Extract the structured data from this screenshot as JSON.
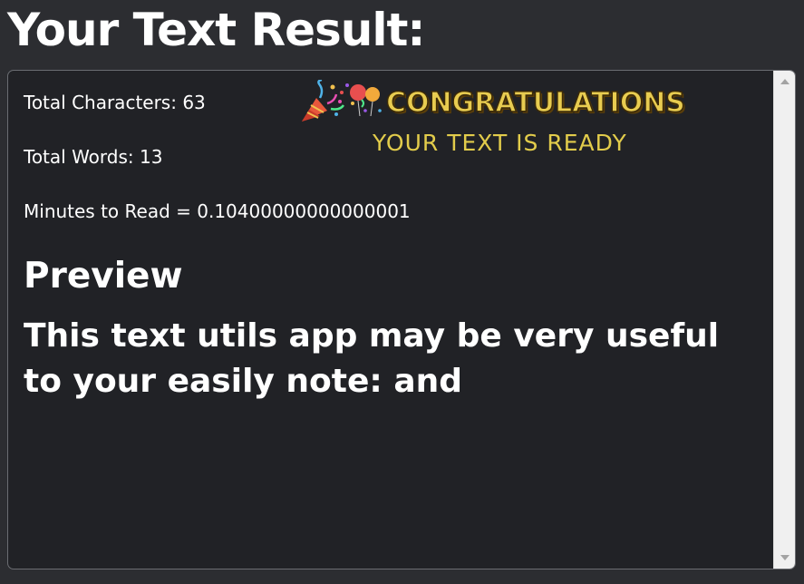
{
  "page": {
    "title": "Your Text Result:"
  },
  "stats": {
    "total_characters": "Total Characters: 63",
    "total_words": "Total Words: 13",
    "minutes_to_read": "Minutes to Read = 0.10400000000000001"
  },
  "congrats": {
    "title": "CONGRATULATIONS",
    "subtitle": "YOUR TEXT IS READY",
    "icon": "party-popper-icon",
    "color": "#e8cc50"
  },
  "preview": {
    "heading": "Preview",
    "text": "This text utils app may be very useful to your easily note: and"
  },
  "colors": {
    "background": "#2c2d31",
    "box_background": "#212226",
    "text": "#ffffff"
  }
}
